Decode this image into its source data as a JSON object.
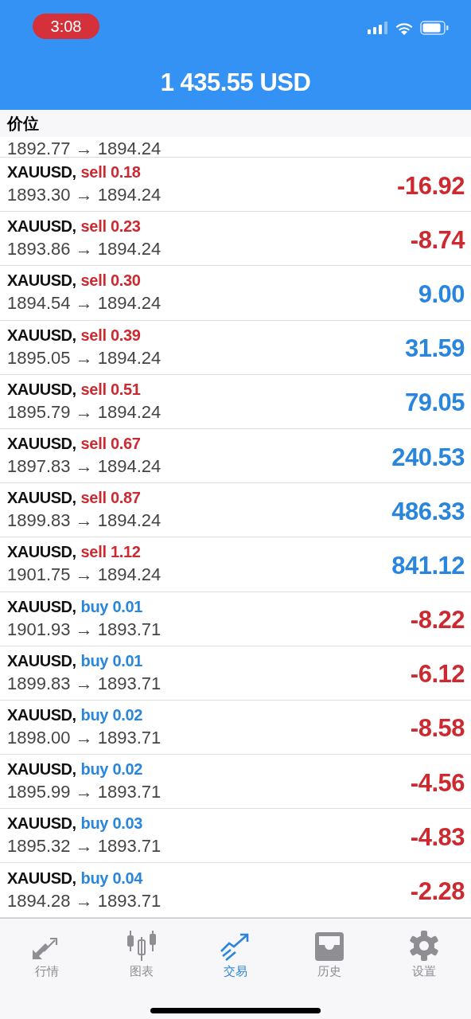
{
  "status_bar": {
    "time": "3:08"
  },
  "header": {
    "title": "1 435.55 USD"
  },
  "section": {
    "title": "价位",
    "partial_prices": "1892.77 → 1894.24"
  },
  "positions": [
    {
      "symbol": "XAUUSD,",
      "kind": "sell",
      "volume": "sell 0.18",
      "prices": "1893.30 → 1894.24",
      "profit": "-16.92",
      "loss": true
    },
    {
      "symbol": "XAUUSD,",
      "kind": "sell",
      "volume": "sell 0.23",
      "prices": "1893.86 → 1894.24",
      "profit": "-8.74",
      "loss": true
    },
    {
      "symbol": "XAUUSD,",
      "kind": "sell",
      "volume": "sell 0.30",
      "prices": "1894.54 → 1894.24",
      "profit": "9.00",
      "loss": false
    },
    {
      "symbol": "XAUUSD,",
      "kind": "sell",
      "volume": "sell 0.39",
      "prices": "1895.05 → 1894.24",
      "profit": "31.59",
      "loss": false
    },
    {
      "symbol": "XAUUSD,",
      "kind": "sell",
      "volume": "sell 0.51",
      "prices": "1895.79 → 1894.24",
      "profit": "79.05",
      "loss": false
    },
    {
      "symbol": "XAUUSD,",
      "kind": "sell",
      "volume": "sell 0.67",
      "prices": "1897.83 → 1894.24",
      "profit": "240.53",
      "loss": false
    },
    {
      "symbol": "XAUUSD,",
      "kind": "sell",
      "volume": "sell 0.87",
      "prices": "1899.83 → 1894.24",
      "profit": "486.33",
      "loss": false
    },
    {
      "symbol": "XAUUSD,",
      "kind": "sell",
      "volume": "sell 1.12",
      "prices": "1901.75 → 1894.24",
      "profit": "841.12",
      "loss": false
    },
    {
      "symbol": "XAUUSD,",
      "kind": "buy",
      "volume": "buy 0.01",
      "prices": "1901.93 → 1893.71",
      "profit": "-8.22",
      "loss": true
    },
    {
      "symbol": "XAUUSD,",
      "kind": "buy",
      "volume": "buy 0.01",
      "prices": "1899.83 → 1893.71",
      "profit": "-6.12",
      "loss": true
    },
    {
      "symbol": "XAUUSD,",
      "kind": "buy",
      "volume": "buy 0.02",
      "prices": "1898.00 → 1893.71",
      "profit": "-8.58",
      "loss": true
    },
    {
      "symbol": "XAUUSD,",
      "kind": "buy",
      "volume": "buy 0.02",
      "prices": "1895.99 → 1893.71",
      "profit": "-4.56",
      "loss": true
    },
    {
      "symbol": "XAUUSD,",
      "kind": "buy",
      "volume": "buy 0.03",
      "prices": "1895.32 → 1893.71",
      "profit": "-4.83",
      "loss": true
    },
    {
      "symbol": "XAUUSD,",
      "kind": "buy",
      "volume": "buy 0.04",
      "prices": "1894.28 → 1893.71",
      "profit": "-2.28",
      "loss": true
    }
  ],
  "tabs": [
    {
      "kind": "quotes",
      "label": "行情",
      "selected": false
    },
    {
      "kind": "chart",
      "label": "图表",
      "selected": false
    },
    {
      "kind": "trade",
      "label": "交易",
      "selected": true
    },
    {
      "kind": "history",
      "label": "历史",
      "selected": false
    },
    {
      "kind": "settings",
      "label": "设置",
      "selected": false
    }
  ]
}
